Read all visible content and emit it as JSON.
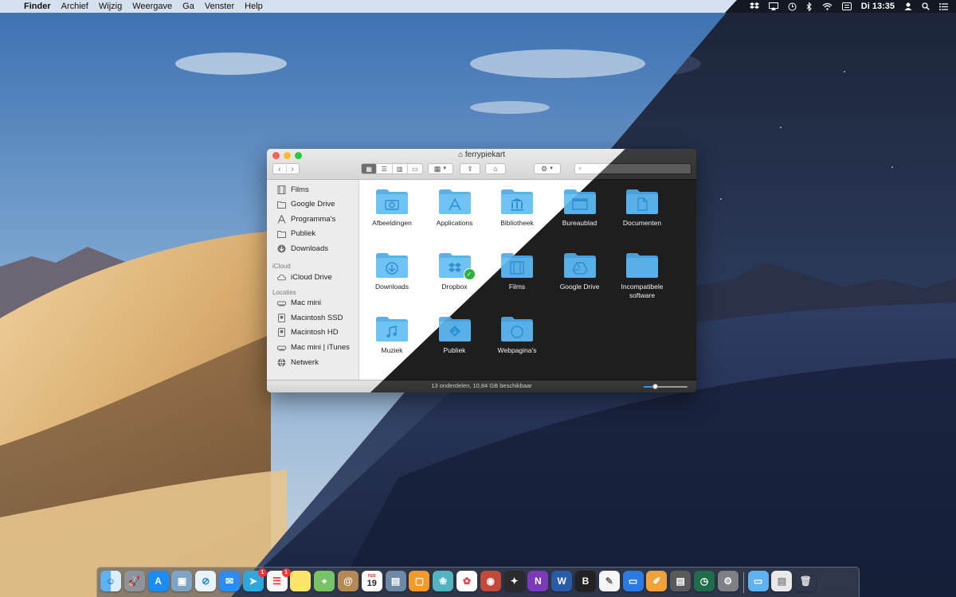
{
  "menubar": {
    "apple_glyph": "",
    "app_name": "Finder",
    "menus": [
      "Archief",
      "Wijzig",
      "Weergave",
      "Ga",
      "Venster",
      "Help"
    ],
    "clock": "Di 13:35"
  },
  "window": {
    "title": "ferrypiekart",
    "search_placeholder": "",
    "status_text": "13 onderdelen, 10,84 GB beschikbaar",
    "icon_size_level": 0.25,
    "sidebar": {
      "favorites": [
        {
          "label": "Films",
          "icon": "films-icon"
        },
        {
          "label": "Google Drive",
          "icon": "folder-icon"
        },
        {
          "label": "Programma's",
          "icon": "applications-icon"
        },
        {
          "label": "Publiek",
          "icon": "folder-icon"
        },
        {
          "label": "Downloads",
          "icon": "downloads-icon"
        }
      ],
      "icloud_header": "iCloud",
      "icloud": [
        {
          "label": "iCloud Drive",
          "icon": "cloud-icon"
        }
      ],
      "locations_header": "Locaties",
      "locations": [
        {
          "label": "Mac mini",
          "icon": "computer-icon"
        },
        {
          "label": "Macintosh SSD",
          "icon": "disk-icon"
        },
        {
          "label": "Macintosh HD",
          "icon": "disk-icon"
        },
        {
          "label": "Mac mini | iTunes",
          "icon": "computer-icon"
        },
        {
          "label": "Netwerk",
          "icon": "network-icon"
        }
      ]
    },
    "items": [
      {
        "label": "Afbeeldingen",
        "glyph": "camera"
      },
      {
        "label": "Applications",
        "glyph": "apps"
      },
      {
        "label": "Bibliotheek",
        "glyph": "library"
      },
      {
        "label": "Bureaublad",
        "glyph": "desktop"
      },
      {
        "label": "Documenten",
        "glyph": "document"
      },
      {
        "label": "Downloads",
        "glyph": "download"
      },
      {
        "label": "Dropbox",
        "glyph": "dropbox"
      },
      {
        "label": "Films",
        "glyph": "film"
      },
      {
        "label": "Google Drive",
        "glyph": "drive"
      },
      {
        "label": "Incompatibele software",
        "glyph": "none"
      },
      {
        "label": "Muziek",
        "glyph": "music"
      },
      {
        "label": "Publiek",
        "glyph": "public"
      },
      {
        "label": "Webpagina's",
        "glyph": "web"
      }
    ]
  },
  "dock": {
    "calendar_month": "FEB",
    "calendar_day": "19",
    "badges": {
      "telegram": "1",
      "reminders": "1"
    },
    "bear_letter": "B",
    "word_letter": "W",
    "onenote_letter": "N"
  },
  "colors": {
    "folder_light": "#6ec3f2",
    "folder_dark": "#58b0e6",
    "accent": "#3d8ef5"
  }
}
